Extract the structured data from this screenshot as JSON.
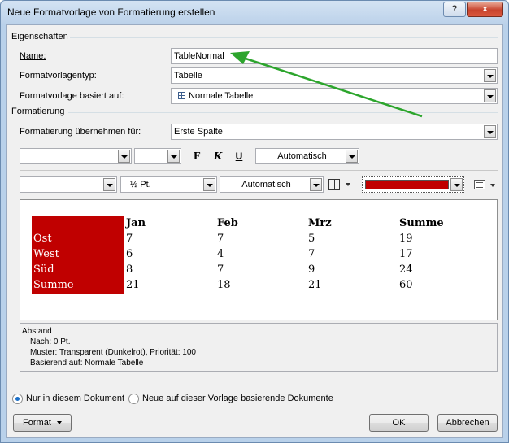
{
  "window": {
    "title": "Neue Formatvorlage von Formatierung erstellen",
    "help_label": "?",
    "close_label": "x"
  },
  "eigenschaften": {
    "heading": "Eigenschaften",
    "name_label": "Name:",
    "name_value": "TableNormal",
    "typ_label": "Formatvorlagentyp:",
    "typ_value": "Tabelle",
    "basiert_label": "Formatvorlage basiert auf:",
    "basiert_value": "Normale Tabelle"
  },
  "formatierung": {
    "heading": "Formatierung",
    "uebernehmen_label": "Formatierung übernehmen für:",
    "uebernehmen_value": "Erste Spalte",
    "font_value": "",
    "size_value": "",
    "bold_label": "F",
    "italic_label": "K",
    "underline_label": "U",
    "font_color_value": "Automatisch",
    "border_weight_value": "½ Pt.",
    "border_color_value": "Automatisch",
    "shading_color": "#c00000"
  },
  "preview": {
    "header": [
      "",
      "Jan",
      "Feb",
      "Mrz",
      "Summe"
    ],
    "rows": [
      [
        "Ost",
        "7",
        "7",
        "5",
        "19"
      ],
      [
        "West",
        "6",
        "4",
        "7",
        "17"
      ],
      [
        "Süd",
        "8",
        "7",
        "9",
        "24"
      ],
      [
        "Summe",
        "21",
        "18",
        "21",
        "60"
      ]
    ],
    "first_column_fill": "#c00000"
  },
  "description": {
    "line1": "Abstand",
    "line2": "Nach:  0 Pt.",
    "line3": "Muster: Transparent (Dunkelrot), Priorität: 100",
    "line4": "Basierend auf: Normale Tabelle"
  },
  "options": {
    "only_doc_label": "Nur in diesem Dokument",
    "new_docs_label": "Neue auf dieser Vorlage basierende Dokumente",
    "selected": "only_doc"
  },
  "buttons": {
    "format_label": "Format",
    "ok_label": "OK",
    "cancel_label": "Abbrechen"
  },
  "annotation": {
    "arrow_color": "#2ca52c"
  }
}
